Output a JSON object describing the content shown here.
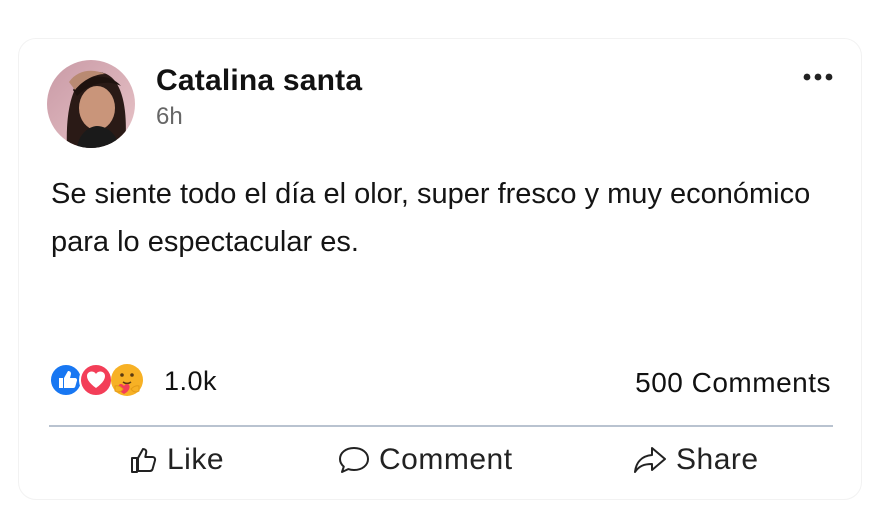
{
  "post": {
    "author": "Catalina santa",
    "time": "6h",
    "text": "Se siente todo el día el olor, super fresco y muy económico para lo espectacular es.",
    "more_icon": "more-horizontal-icon"
  },
  "reactions": {
    "icons": [
      "like-reaction-icon",
      "love-reaction-icon",
      "care-reaction-icon"
    ],
    "count": "1.0k",
    "comments": "500 Comments"
  },
  "actions": {
    "like": "Like",
    "comment": "Comment",
    "share": "Share"
  },
  "colors": {
    "like_blue": "#1877f2",
    "love_red": "#f33e58",
    "care_yellow": "#f7b125",
    "divider": "#b9c3d0"
  }
}
